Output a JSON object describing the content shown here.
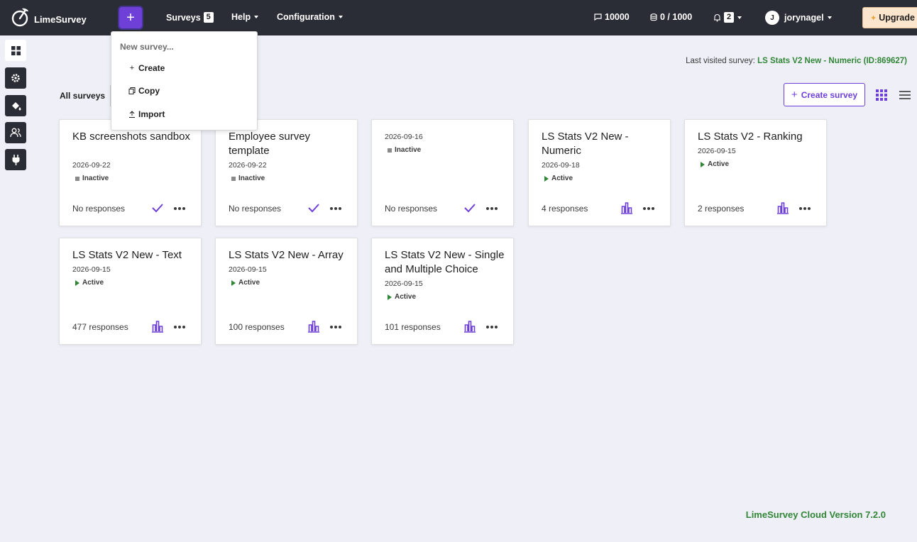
{
  "app": {
    "logo_text": "LimeSurvey",
    "brand_color": "#6e40d8",
    "status_active_color": "#328637"
  },
  "topbar": {
    "new_button_icon": "plus-icon",
    "surveys_label": "Surveys",
    "surveys_count": "5",
    "help_label": "Help",
    "configuration_label": "Configuration",
    "responses_count": "10000",
    "storage_label": "0 / 1000",
    "notifications_count": "2",
    "user_initial": "J",
    "username": "jorynagel",
    "upgrade_label": "Upgrade"
  },
  "dropdown": {
    "header": "New survey...",
    "items": [
      {
        "label": "Create",
        "icon": "plus-icon"
      },
      {
        "label": "Copy",
        "icon": "copy-icon"
      },
      {
        "label": "Import",
        "icon": "upload-icon"
      }
    ]
  },
  "sidebar": {
    "items": [
      {
        "icon": "dashboard-icon"
      },
      {
        "icon": "settings-icon"
      },
      {
        "icon": "paint-bucket-icon"
      },
      {
        "icon": "users-icon"
      },
      {
        "icon": "plug-icon"
      }
    ]
  },
  "last_visited": {
    "label": "Last visited survey:",
    "survey": "LS Stats V2 New - Numeric (ID:869627)"
  },
  "filters": {
    "all_surveys_label": "All surveys"
  },
  "actions": {
    "create_survey_label": "Create survey"
  },
  "surveys": [
    {
      "title": "KB screenshots sandbox",
      "date": "2026-09-22",
      "status": "Inactive",
      "responses": "No responses"
    },
    {
      "title": "Employee survey template",
      "date": "2026-09-22",
      "status": "Inactive",
      "responses": "No responses"
    },
    {
      "title": "",
      "date": "2026-09-16",
      "status": "Inactive",
      "responses": "No responses"
    },
    {
      "title": "LS Stats V2 New - Numeric",
      "date": "2026-09-18",
      "status": "Active",
      "responses": "4 responses"
    },
    {
      "title": "LS Stats V2 - Ranking",
      "date": "2026-09-15",
      "status": "Active",
      "responses": "2 responses"
    },
    {
      "title": "LS Stats V2 New - Text",
      "date": "2026-09-15",
      "status": "Active",
      "responses": "477 responses"
    },
    {
      "title": "LS Stats V2 New - Array",
      "date": "2026-09-15",
      "status": "Active",
      "responses": "100 responses"
    },
    {
      "title": "LS Stats V2 New - Single and Multiple Choice",
      "date": "2026-09-15",
      "status": "Active",
      "responses": "101 responses"
    }
  ],
  "footer": {
    "version": "LimeSurvey Cloud Version 7.2.0"
  }
}
